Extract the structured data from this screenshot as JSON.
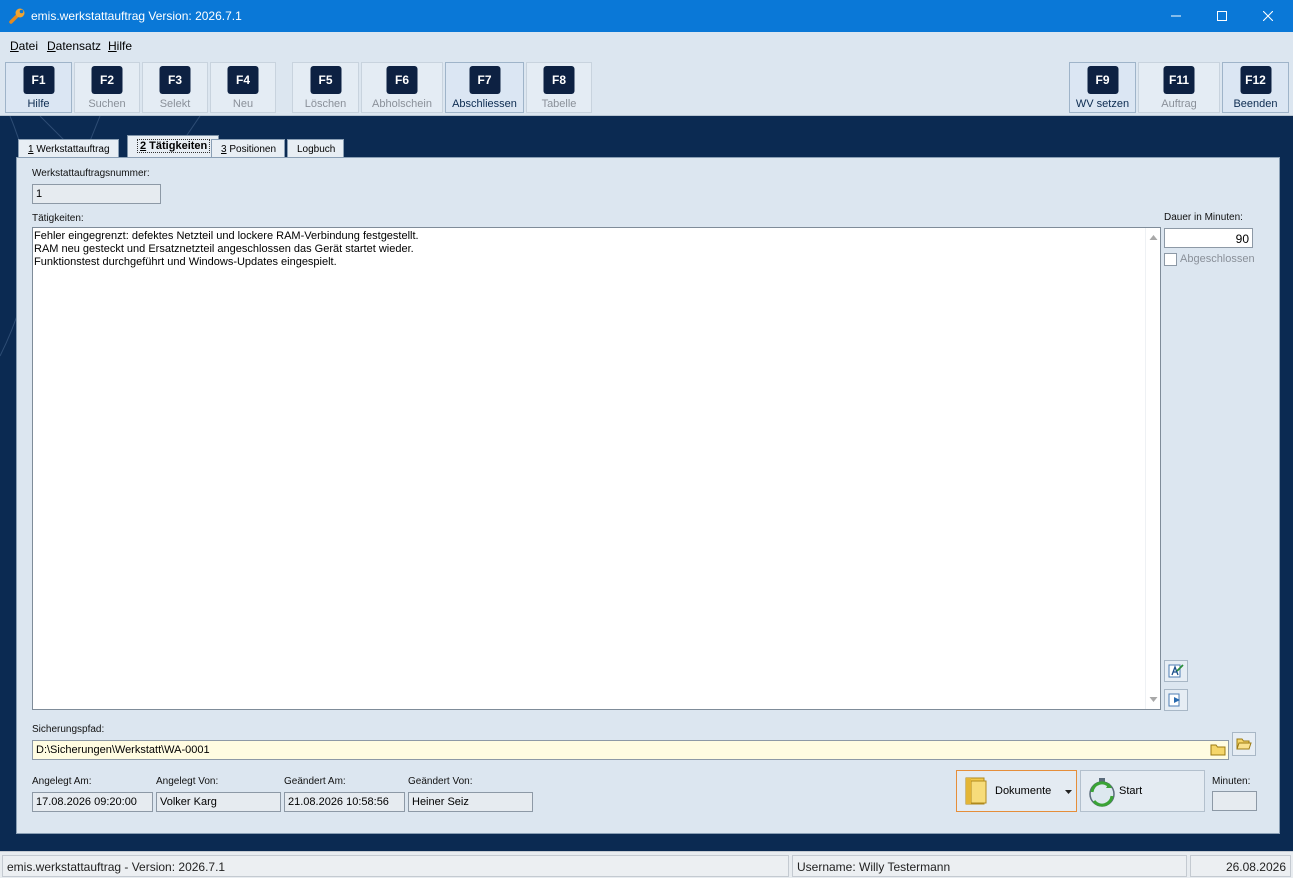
{
  "window": {
    "title": "emis.werkstattauftrag Version: 2026.7.1",
    "minimize_glyph": "—",
    "maximize_glyph": "☐",
    "close_glyph": "✕"
  },
  "menu": [
    "Datei",
    "Datensatz",
    "Hilfe"
  ],
  "toolbar": {
    "buttons": [
      {
        "key": "F1",
        "label": "Hilfe"
      },
      {
        "key": "F2",
        "label": "Suchen"
      },
      {
        "key": "F3",
        "label": "Selekt"
      },
      {
        "key": "F4",
        "label": "Neu"
      },
      {
        "key": "F5",
        "label": "Löschen"
      },
      {
        "key": "F6",
        "label": "Abholschein"
      },
      {
        "key": "F7",
        "label": "Abschliessen"
      },
      {
        "key": "F8",
        "label": "Tabelle"
      },
      {
        "key": "F9",
        "label": "WV setzen"
      },
      {
        "key": "F11",
        "label": "Auftrag"
      },
      {
        "key": "F12",
        "label": "Beenden"
      }
    ]
  },
  "tabs": [
    {
      "num": "1",
      "text": " Werkstattauftrag"
    },
    {
      "num": "2",
      "text": " Tätigkeiten"
    },
    {
      "num": "3",
      "text": " Positionen"
    },
    {
      "num": "",
      "text": "Logbuch"
    }
  ],
  "form": {
    "order_number_label": "Werkstattauftragsnummer:",
    "order_number": "1",
    "activities_label": "Tätigkeiten:",
    "activities_lines": [
      "Fehler eingegrenzt: defektes Netzteil und lockere RAM-Verbindung festgestellt.",
      "RAM neu gesteckt und Ersatznetzteil angeschlossen  das Gerät startet wieder.",
      "Funktionstest durchgeführt und Windows-Updates eingespielt."
    ],
    "duration_label": "Dauer in Minuten:",
    "duration": "90",
    "completed_label": "Abgeschlossen",
    "backup_path_label": "Sicherungspfad:",
    "backup_path": "D:\\Sicherungen\\Werkstatt\\WA-0001",
    "created_at_label": "Angelegt Am:",
    "created_at": "17.08.2026 09:20:00",
    "created_by_label": "Angelegt Von:",
    "created_by": "Volker Karg",
    "changed_at_label": "Geändert Am:",
    "changed_at": "21.08.2026 10:58:56",
    "changed_by_label": "Geändert Von:",
    "changed_by": "Heiner Seiz",
    "documents_label": "Dokumente",
    "start_label": "Start",
    "minutes_label": "Minuten:"
  },
  "status": {
    "app": "emis.werkstattauftrag - Version: 2026.7.1",
    "user": "Username: Willy Testermann",
    "date": "26.08.2026"
  },
  "colors": {
    "titlebar": "#0a78d7",
    "background": "#0b2a52",
    "key_badge": "#0d2142",
    "document_border": "#e58e3a"
  }
}
